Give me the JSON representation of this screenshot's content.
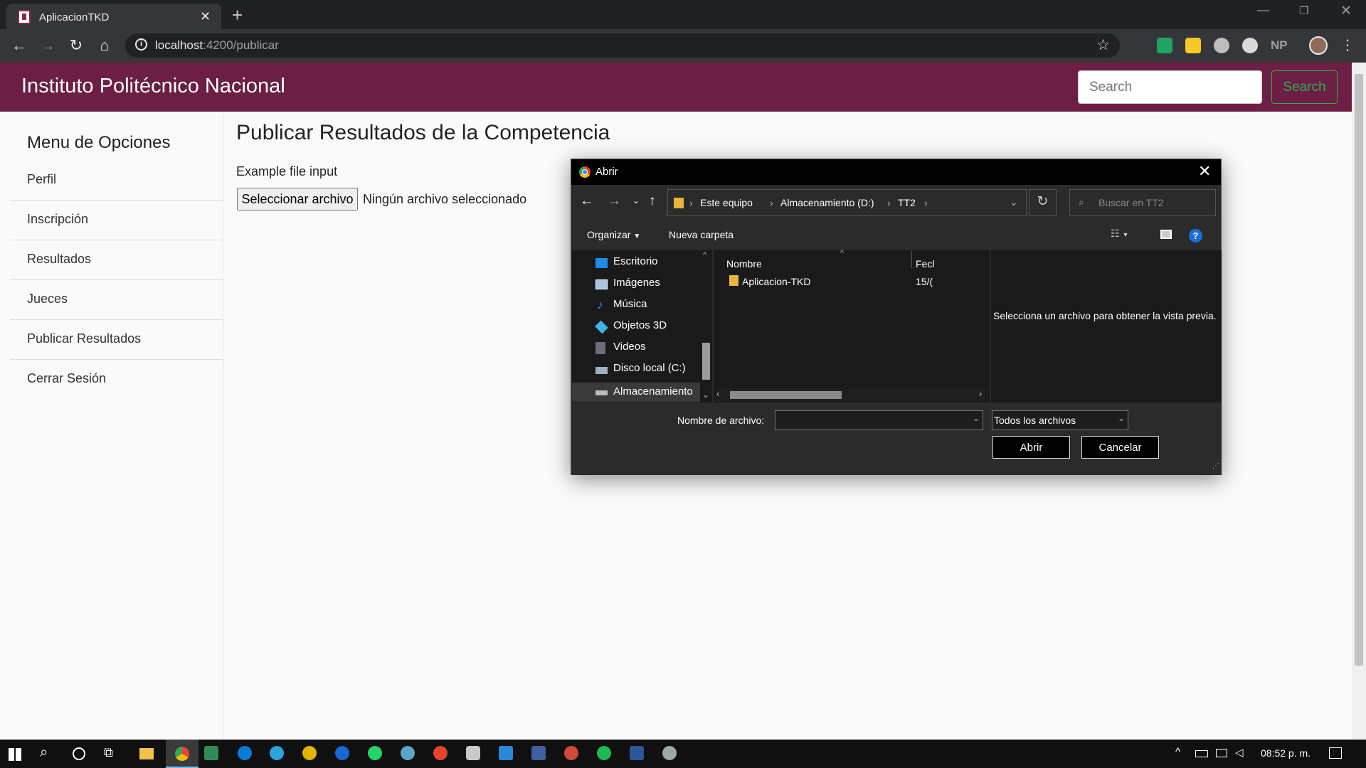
{
  "browser": {
    "tab_title": "AplicacionTKD",
    "new_tab": "+",
    "url_host": "localhost",
    "url_path": ":4200/publicar",
    "ext_np": "NP"
  },
  "header": {
    "brand": "Instituto Politécnico Nacional",
    "search_placeholder": "Search",
    "search_button": "Search"
  },
  "sidebar": {
    "title": "Menu de Opciones",
    "items": [
      "Perfil",
      "Inscripción",
      "Resultados",
      "Jueces",
      "Publicar Resultados",
      "Cerrar Sesión"
    ]
  },
  "main": {
    "title": "Publicar Resultados de la Competencia",
    "file_label": "Example file input",
    "file_button": "Seleccionar archivo",
    "file_status": "Ningún archivo seleccionado"
  },
  "dialog": {
    "title": "Abrir",
    "breadcrumb": [
      "Este equipo",
      "Almacenamiento (D:)",
      "TT2"
    ],
    "search_placeholder": "Buscar en TT2",
    "organize": "Organizar",
    "new_folder": "Nueva carpeta",
    "help": "?",
    "nav_items": [
      "Escritorio",
      "Imágenes",
      "Música",
      "Objetos 3D",
      "Videos",
      "Disco local (C:)",
      "Almacenamiento"
    ],
    "col_name": "Nombre",
    "col_date": "Fecl",
    "files": [
      {
        "name": "Aplicacion-TKD",
        "date": "15/("
      }
    ],
    "preview_msg": "Selecciona un archivo para obtener la vista previa.",
    "filename_label": "Nombre de archivo:",
    "filetype": "Todos los archivos",
    "open": "Abrir",
    "cancel": "Cancelar"
  },
  "taskbar": {
    "time": "08:52 p. m."
  }
}
